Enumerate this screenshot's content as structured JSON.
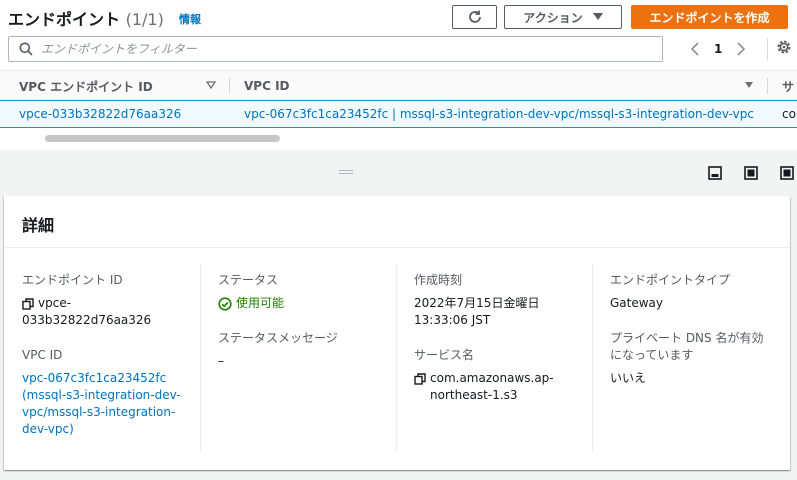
{
  "header": {
    "title": "エンドポイント",
    "count": "(1/1)",
    "info_link": "情報",
    "actions_label": "アクション",
    "create_label": "エンドポイントを作成"
  },
  "search": {
    "placeholder": "エンドポイントをフィルター",
    "value": ""
  },
  "pagination": {
    "current_page": "1"
  },
  "table": {
    "columns": [
      "VPC エンドポイント ID",
      "VPC ID",
      "サ"
    ],
    "rows": [
      {
        "endpoint_id": "vpce-033b32822d76aa326",
        "vpc_id": "vpc-067c3fc1ca23452fc | mssql-s3-integration-dev-vpc/mssql-s3-integration-dev-vpc",
        "service": "con"
      }
    ]
  },
  "details": {
    "title": "詳細",
    "endpoint_id_label": "エンドポイント ID",
    "endpoint_id_lines": [
      "vpce-",
      "033b32822d76aa326"
    ],
    "vpc_id_label": "VPC ID",
    "vpc_id_lines": [
      "vpc-067c3fc1ca23452fc",
      "(mssql-s3-integration-dev-",
      "vpc/mssql-s3-integration-",
      "dev-vpc)"
    ],
    "status_label": "ステータス",
    "status_value": "使用可能",
    "status_message_label": "ステータスメッセージ",
    "status_message_value": "–",
    "created_label": "作成時刻",
    "created_lines": [
      "2022年7月15日金曜日",
      "13:33:06 JST"
    ],
    "service_name_label": "サービス名",
    "service_name_lines": [
      "com.amazonaws.ap-",
      "northeast-1.s3"
    ],
    "endpoint_type_label": "エンドポイントタイプ",
    "endpoint_type_value": "Gateway",
    "private_dns_label_lines": [
      "プライベート DNS 名が有効",
      "になっています"
    ],
    "private_dns_value": "いいえ"
  },
  "colors": {
    "accent": "#ec7211",
    "link": "#0073bb",
    "success": "#1d8102",
    "selected_row": "#f1faff"
  },
  "icons": [
    "refresh-icon",
    "caret-down-icon",
    "search-icon",
    "chevron-left-icon",
    "chevron-right-icon",
    "gear-icon",
    "sort-caret-icon",
    "copy-icon",
    "check-circle-icon",
    "drag-handle-icon",
    "panel-bottom-icon",
    "panel-side-icon",
    "panel-full-icon"
  ]
}
